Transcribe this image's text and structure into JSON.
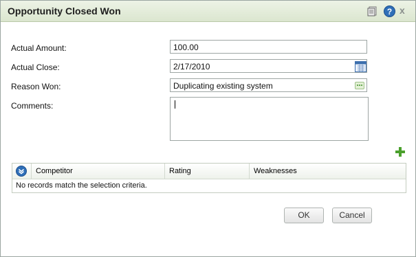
{
  "dialog": {
    "title": "Opportunity Closed Won",
    "icons": [
      "clipboard-icon",
      "help-icon",
      "close-icon"
    ],
    "close_glyph": "x",
    "help_glyph": "?"
  },
  "form": {
    "actual_amount_label": "Actual Amount:",
    "actual_amount_value": "100.00",
    "actual_close_label": "Actual Close:",
    "actual_close_value": "2/17/2010",
    "reason_won_label": "Reason Won:",
    "reason_won_value": "Duplicating existing system",
    "comments_label": "Comments:",
    "comments_value": ""
  },
  "competitors": {
    "columns": [
      "Competitor",
      "Rating",
      "Weaknesses"
    ],
    "empty_message": "No records match the selection criteria."
  },
  "buttons": {
    "ok": "OK",
    "cancel": "Cancel"
  },
  "colors": {
    "titlebar": "#dbe6cf",
    "accent_green": "#4aa02c",
    "help_blue": "#2f6fb8"
  }
}
